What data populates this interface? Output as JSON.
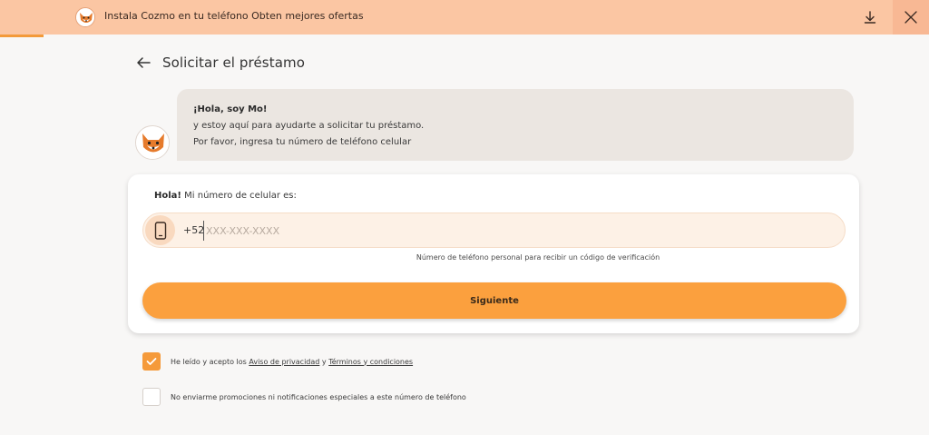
{
  "banner": {
    "text": "Instala Cozmo en tu teléfono Obten mejores ofertas",
    "logo_icon": "fox-avatar-icon",
    "download_icon": "download-icon",
    "close_icon": "close-icon"
  },
  "header": {
    "back_icon": "arrow-left-icon",
    "title": "Solicitar el préstamo"
  },
  "chat": {
    "greeting": "¡Hola, soy Mo!",
    "line1": "y estoy aquí para ayudarte a solicitar tu préstamo.",
    "line2": "Por favor, ingresa tu número de teléfono celular"
  },
  "form": {
    "label_bold": "Hola!",
    "label_rest": " Mi número de celular es:",
    "phone_icon": "mobile-phone-icon",
    "prefix": "+52",
    "placeholder": "XXX-XXX-XXXX",
    "value": "",
    "helper": "Número de teléfono personal para recibir un código de verificación",
    "submit_label": "Siguiente"
  },
  "consent": {
    "checked": true,
    "prefix": "He leído y acepto los ",
    "privacy_link": "Aviso de privacidad",
    "joiner": " y ",
    "terms_link": "Términos y condiciones"
  },
  "promo": {
    "checked": false,
    "text": "No enviarme promociones ni notificaciones especiales a este número de teléfono"
  },
  "colors": {
    "accent": "#fba03e",
    "banner": "#fbc6a3",
    "background": "#f8f7f6"
  }
}
